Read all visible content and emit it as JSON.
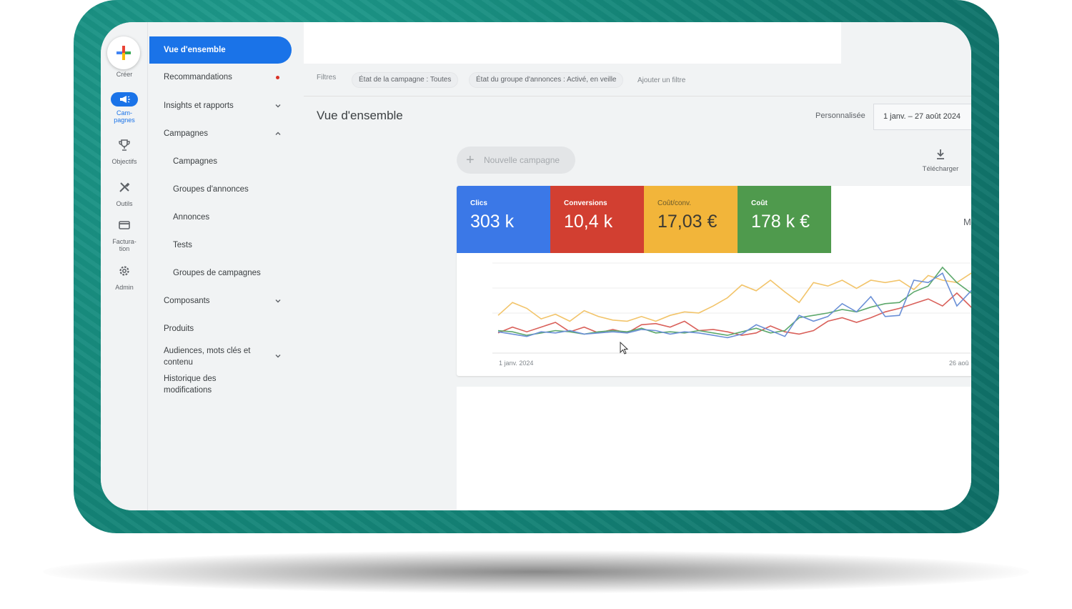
{
  "rail": {
    "create_label": "Créer",
    "campaigns_label": "Cam-\npagnes",
    "goals_label": "Objectifs",
    "tools_label": "Outils",
    "billing_label": "Factura-\ntion",
    "admin_label": "Admin"
  },
  "nav": {
    "overview": "Vue d'ensemble",
    "recommendations": "Recommandations",
    "insights": "Insights et rapports",
    "campaigns": "Campagnes",
    "sub_campaigns": "Campagnes",
    "sub_ad_groups": "Groupes d'annonces",
    "sub_ads": "Annonces",
    "sub_tests": "Tests",
    "sub_campaign_groups": "Groupes de campagnes",
    "components": "Composants",
    "products": "Produits",
    "audiences": "Audiences, mots clés et contenu",
    "history": "Historique des modifications"
  },
  "filters": {
    "label": "Filtres",
    "chip_campaign": "État de la campagne : Toutes",
    "chip_adgroup": "État du groupe d'annonces : Activé, en veille",
    "add": "Ajouter un filtre"
  },
  "page": {
    "title": "Vue d'ensemble",
    "date_label": "Personnalisée",
    "date_range": "1 janv. – 27 août 2024",
    "new_campaign": "Nouvelle campagne",
    "download": "Télécharger"
  },
  "metrics": [
    {
      "label": "Clics",
      "value": "303 k",
      "color": "#3b78e7"
    },
    {
      "label": "Conversions",
      "value": "10,4 k",
      "color": "#d23f31"
    },
    {
      "label": "Coût/conv.",
      "value": "17,03 €",
      "color": "#f2b53a"
    },
    {
      "label": "Coût",
      "value": "178 k €",
      "color": "#4f9a4d"
    }
  ],
  "metrics_peek": "M",
  "chart_data": {
    "type": "line",
    "x_start_label": "1 janv. 2024",
    "x_end_label": "26 aoû",
    "series": [
      {
        "color": "#f2c46a",
        "values": [
          40,
          62,
          52,
          34,
          42,
          30,
          48,
          38,
          32,
          30,
          38,
          30,
          40,
          46,
          44,
          56,
          70,
          92,
          82,
          100,
          80,
          62,
          96,
          90,
          100,
          86,
          100,
          96,
          100,
          84,
          108,
          100,
          96,
          112,
          124
        ]
      },
      {
        "color": "#d9605a",
        "values": [
          10,
          20,
          12,
          20,
          28,
          12,
          20,
          10,
          16,
          10,
          24,
          26,
          20,
          30,
          14,
          16,
          12,
          6,
          10,
          22,
          12,
          8,
          14,
          30,
          36,
          28,
          36,
          46,
          52,
          60,
          68,
          56,
          78,
          54,
          60
        ]
      },
      {
        "color": "#5ca86b",
        "values": [
          14,
          12,
          6,
          10,
          14,
          12,
          8,
          12,
          14,
          12,
          18,
          10,
          12,
          10,
          14,
          10,
          6,
          12,
          18,
          10,
          14,
          36,
          40,
          44,
          50,
          46,
          54,
          60,
          62,
          80,
          90,
          122,
          96,
          78,
          62
        ]
      },
      {
        "color": "#6a8fd6",
        "values": [
          12,
          8,
          4,
          12,
          10,
          14,
          8,
          10,
          12,
          10,
          16,
          14,
          8,
          12,
          10,
          6,
          2,
          8,
          24,
          14,
          4,
          40,
          30,
          38,
          60,
          46,
          72,
          38,
          40,
          100,
          96,
          112,
          56,
          82,
          52
        ]
      }
    ]
  }
}
